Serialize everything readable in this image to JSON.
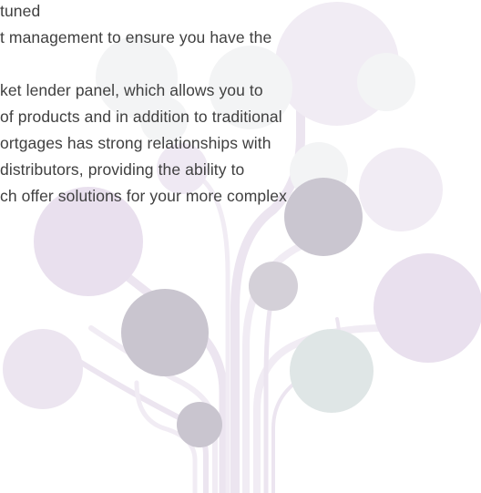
{
  "body_text": {
    "lines": [
      "tuned",
      "t management to ensure you have the",
      "",
      "ket lender panel, which allows you to",
      "of products and in addition to traditional",
      "ortgages has strong relationships with",
      "distributors, providing the ability to",
      "ch offer solutions for your more complex"
    ]
  },
  "colors": {
    "text": "#3f3f3f",
    "lilac": "#e9e0ee",
    "lilac_light": "#f1ecf4",
    "gray_purple": "#c9c5cf",
    "gray_green": "#dfe6e6",
    "pale_gray": "#f3f4f5",
    "branch_light": "#ece5f0"
  }
}
